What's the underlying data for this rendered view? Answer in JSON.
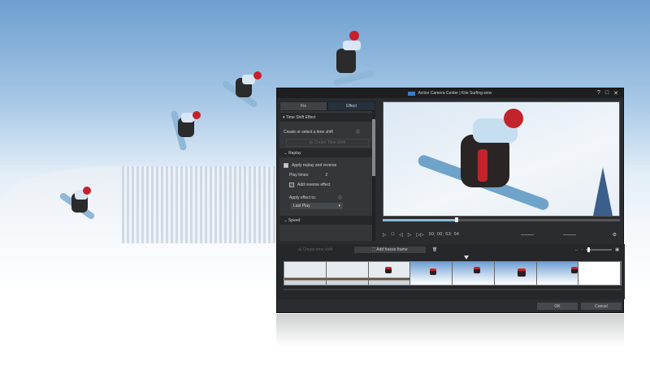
{
  "window": {
    "title": "Action Camera Center | Kite Surfing.wmv",
    "controls": {
      "help": "?",
      "maximize": "□",
      "close": "✕"
    }
  },
  "left_panel": {
    "tabs": [
      {
        "label": "Fix"
      },
      {
        "label": "Effect"
      }
    ],
    "time_shift": {
      "section": "Time Shift Effect",
      "prompt": "Create or select a time shift",
      "create_button": "Create Time Shift"
    },
    "replay": {
      "section": "Replay",
      "apply_label": "Apply replay and reverse",
      "play_times_label": "Play times:",
      "play_times_value": "2",
      "reverse_label": "Add reverse effect",
      "apply_to_label": "Apply effect to:",
      "apply_to_value": "Last Play"
    },
    "speed": {
      "section": "Speed"
    }
  },
  "player": {
    "timecode": "00; 00; 03; 04",
    "progress_percent": 31
  },
  "timeline": {
    "create_time_shift": "Create time shift",
    "add_freeze_frame": "Add freeze frame",
    "zoom_level_percent": 5
  },
  "footer": {
    "ok": "OK",
    "cancel": "Cancel"
  },
  "colors": {
    "accent": "#8ab8d9",
    "window_bg": "#2a2c2f"
  }
}
